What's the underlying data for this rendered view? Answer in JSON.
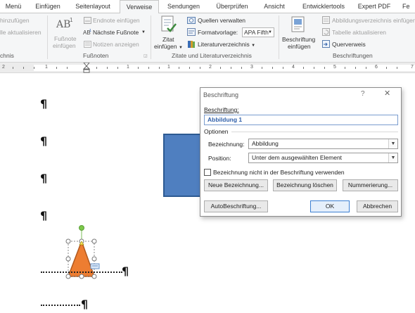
{
  "tabs": [
    "Menü",
    "Einfügen",
    "Seitenlayout",
    "Verweise",
    "Sendungen",
    "Überprüfen",
    "Ansicht",
    "Entwicklertools",
    "Expert PDF",
    "Fe"
  ],
  "active_tab": "Verweise",
  "ribbon": {
    "toc_partial_1": "hinzufügen",
    "toc_partial_2": "lle aktualisieren",
    "toc_group_partial": "chnis",
    "footnote": {
      "insert_footnote_1": "Fußnote",
      "insert_footnote_2": "einfügen",
      "endnote": "Endnote einfügen",
      "next_footnote": "Nächste Fußnote",
      "show_notes": "Notizen anzeigen",
      "group_label": "Fußnoten",
      "ab_glyph": "AB",
      "sup_glyph": "1"
    },
    "citations": {
      "cite_1": "Zitat",
      "cite_2": "einfügen",
      "manage_sources": "Quellen verwalten",
      "style_label": "Formatvorlage:",
      "style_value": "APA Fifth",
      "bibliography": "Literaturverzeichnis",
      "group_label": "Zitate und Literaturverzeichnis"
    },
    "captions": {
      "insert_caption_1": "Beschriftung",
      "insert_caption_2": "einfügen",
      "table_of_figures": "Abbildungsverzeichnis einfügen",
      "update_table": "Tabelle aktualisieren",
      "cross_reference": "Querverweis",
      "group_label": "Beschriftungen"
    }
  },
  "ruler": {
    "labels": [
      "2",
      "1",
      "1",
      "1",
      "2",
      "3",
      "4",
      "5",
      "6",
      "7"
    ]
  },
  "document": {
    "pilcrow": "¶"
  },
  "dialog": {
    "title": "Beschriftung",
    "help": "?",
    "close": "✕",
    "caption_label": "Beschriftung:",
    "caption_value": "Abbildung 1",
    "options_label": "Optionen",
    "label_label": "Bezeichnung:",
    "label_value": "Abbildung",
    "position_label": "Position:",
    "position_value": "Unter dem ausgewählten Element",
    "exclude_label": "Bezeichnung nicht in der Beschriftung verwenden",
    "exclude_checked": false,
    "new_label_button": "Neue Bezeichnung...",
    "delete_label_button": "Bezeichnung löschen",
    "numbering_button": "Nummerierung...",
    "autocaption_button": "AutoBeschriftung...",
    "ok_button": "OK",
    "cancel_button": "Abbrechen"
  },
  "colors": {
    "shape_blue": "#4f7fc0",
    "shape_orange": "#ed7d31",
    "accent_blue": "#2f5faa"
  }
}
